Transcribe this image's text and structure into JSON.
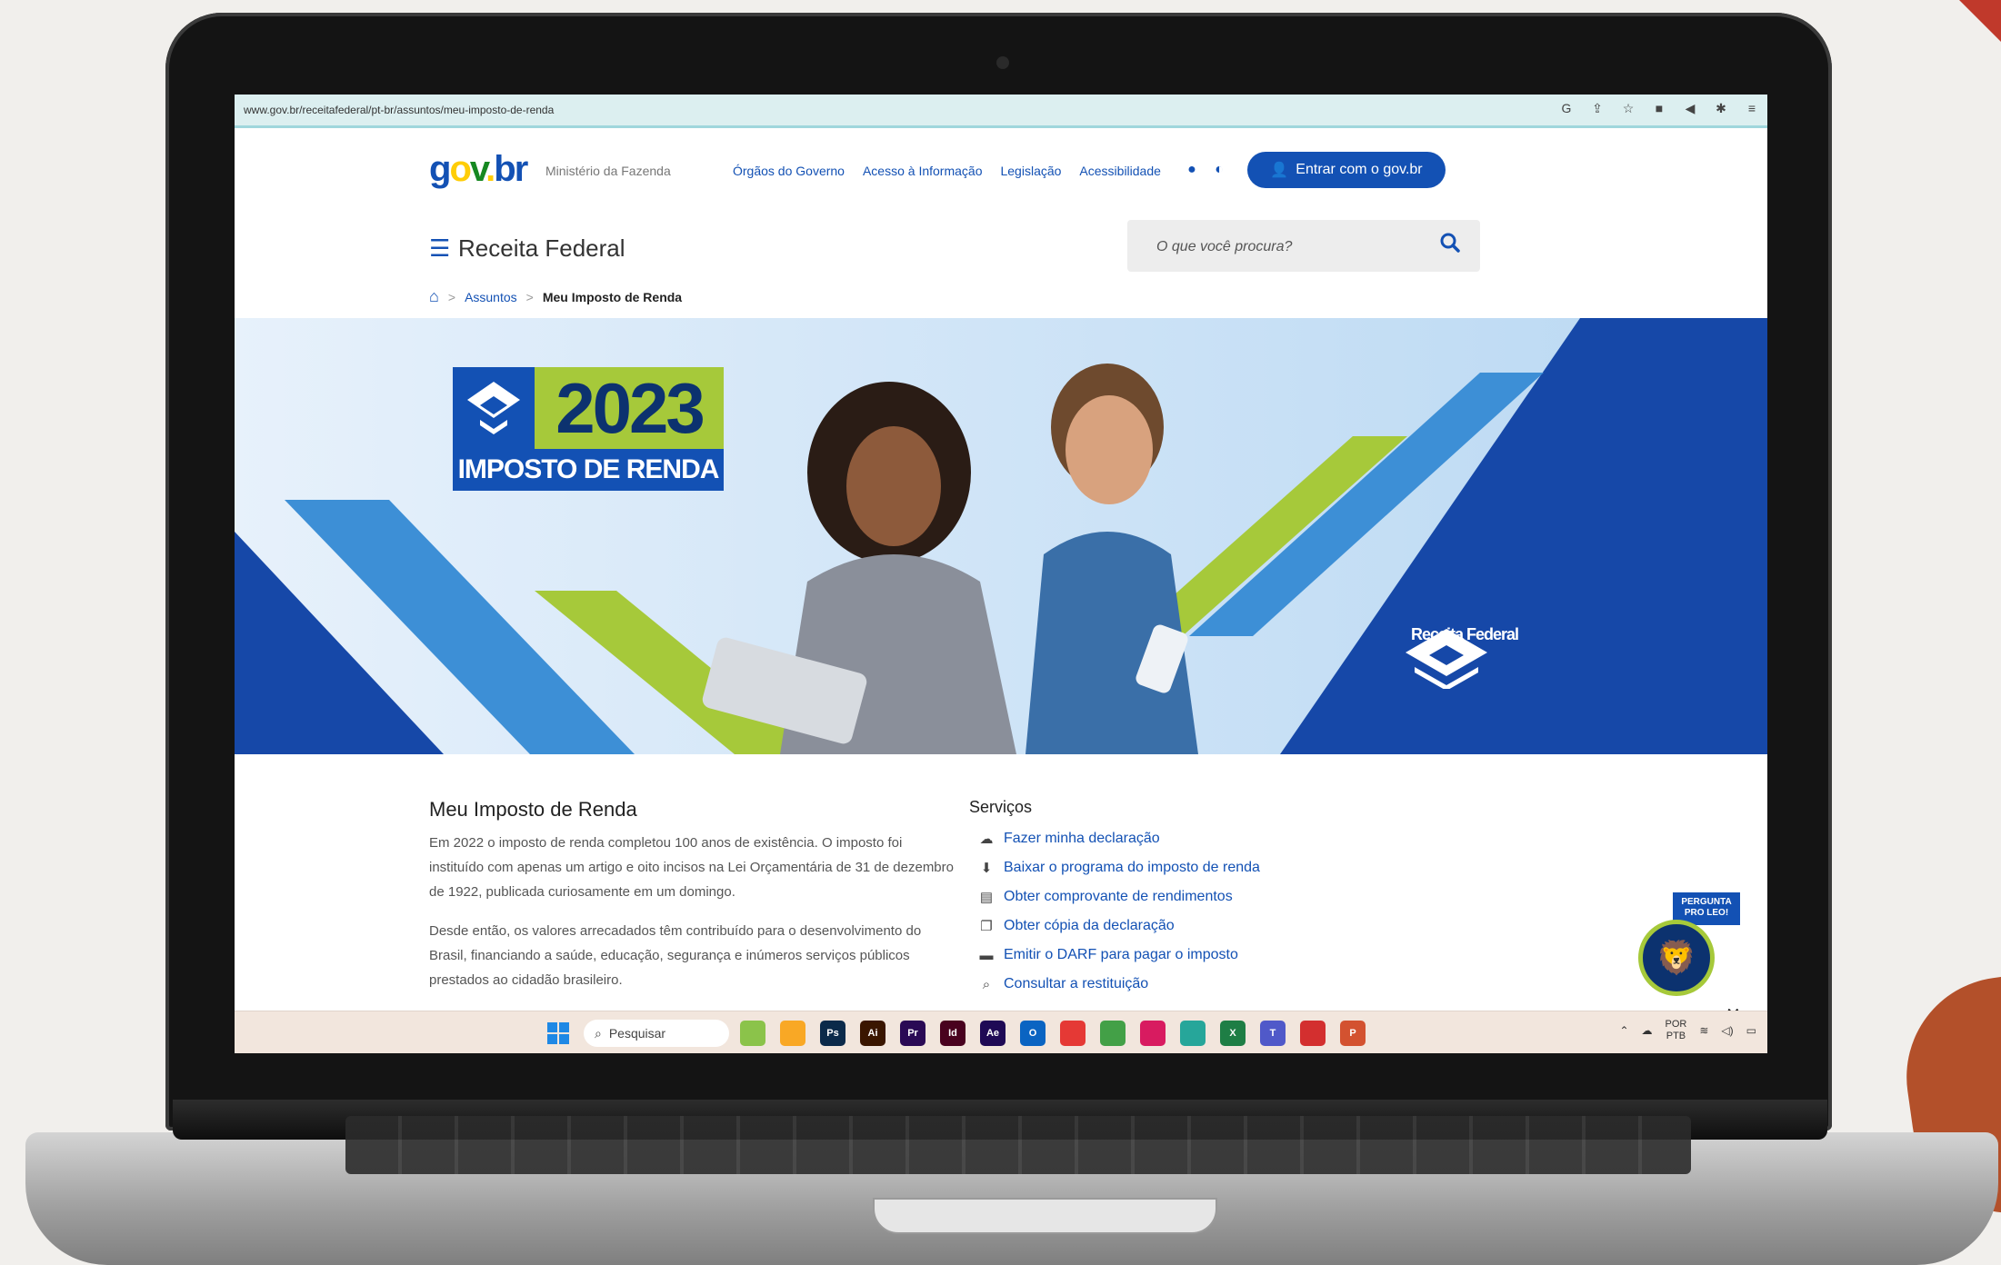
{
  "browser": {
    "url": "www.gov.br/receitafederal/pt-br/assuntos/meu-imposto-de-renda",
    "extensions": [
      "G",
      "⇪",
      "☆",
      "■",
      "◀",
      "✱",
      "≡"
    ]
  },
  "header": {
    "logo": {
      "g": "g",
      "o": "o",
      "v": "v",
      "dot": ".",
      "br": "br"
    },
    "ministry": "Ministério da Fazenda",
    "links": [
      "Órgãos do Governo",
      "Acesso à Informação",
      "Legislação",
      "Acessibilidade"
    ],
    "login_label": "Entrar com o gov.br"
  },
  "site": {
    "title": "Receita Federal",
    "search_placeholder": "O que você procura?"
  },
  "breadcrumb": {
    "items": [
      "Assuntos"
    ],
    "current": "Meu Imposto de Renda"
  },
  "hero": {
    "year": "2023",
    "subtitle": "IMPOSTO DE RENDA",
    "brand": "Receita Federal"
  },
  "intro": {
    "title": "Meu Imposto de Renda",
    "paragraphs": [
      "Em 2022 o imposto de renda completou 100 anos de existência. O imposto foi instituído com apenas um artigo e oito incisos na Lei Orçamentária de 31 de dezembro de 1922, publicada curiosamente em um domingo.",
      "Desde então, os valores arrecadados têm contribuído para o desenvolvimento do Brasil, financiando a saúde, educação, segurança e inúmeros serviços públicos prestados ao cidadão brasileiro."
    ]
  },
  "services": {
    "title": "Serviços",
    "items": [
      {
        "label": "Fazer minha declaração",
        "icon": "cloud-upload-icon"
      },
      {
        "label": "Baixar o programa do imposto de renda",
        "icon": "download-icon"
      },
      {
        "label": "Obter comprovante de rendimentos",
        "icon": "file-icon"
      },
      {
        "label": "Obter cópia da declaração",
        "icon": "copy-icon"
      },
      {
        "label": "Emitir o DARF para pagar o imposto",
        "icon": "credit-card-icon"
      },
      {
        "label": "Consultar a restituição",
        "icon": "search-icon"
      }
    ]
  },
  "assistant": {
    "bubble": "PERGUNTA PRO LEO!"
  },
  "taskbar": {
    "search_label": "Pesquisar",
    "apps": [
      {
        "name": "files-app",
        "label": "",
        "color": "#8bc34a"
      },
      {
        "name": "explorer-app",
        "label": "",
        "color": "#f9a825"
      },
      {
        "name": "photoshop-app",
        "label": "Ps",
        "color": "#0b2a4a"
      },
      {
        "name": "illustrator-app",
        "label": "Ai",
        "color": "#3a1600"
      },
      {
        "name": "premiere-app",
        "label": "Pr",
        "color": "#2a0a55"
      },
      {
        "name": "indesign-app",
        "label": "Id",
        "color": "#49021f"
      },
      {
        "name": "aftereffects-app",
        "label": "Ae",
        "color": "#1f0a55"
      },
      {
        "name": "outlook-app",
        "label": "O",
        "color": "#0a64c2"
      },
      {
        "name": "chrome-app",
        "label": "",
        "color": "#e53935"
      },
      {
        "name": "chrome-profile-app",
        "label": "",
        "color": "#43a047"
      },
      {
        "name": "snipping-app",
        "label": "",
        "color": "#d81b60"
      },
      {
        "name": "notepad-app",
        "label": "",
        "color": "#26a69a"
      },
      {
        "name": "excel-app",
        "label": "X",
        "color": "#1e7e45"
      },
      {
        "name": "teams-app",
        "label": "T",
        "color": "#5059c9"
      },
      {
        "name": "acrobat-app",
        "label": "",
        "color": "#d32f2f"
      },
      {
        "name": "powerpoint-app",
        "label": "P",
        "color": "#d35230"
      }
    ],
    "lang_top": "POR",
    "lang_bottom": "PTB"
  }
}
